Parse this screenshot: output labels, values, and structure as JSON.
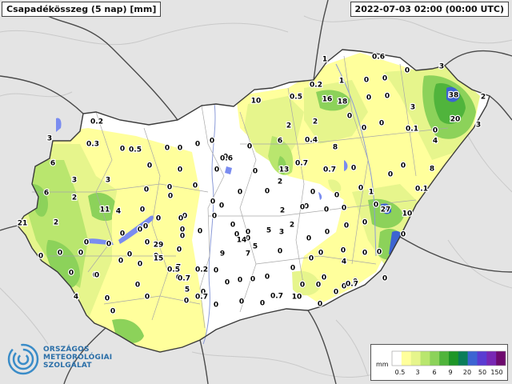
{
  "header": {
    "title": "Csapadékösszeg (5 nap) [mm]",
    "timestamp": "2022-07-03 02:00 (00:00 UTC)"
  },
  "logo": {
    "icon": "spiral-logo-icon",
    "lines": [
      "ORSZÁGOS",
      "METEOROLÓGIAI",
      "SZOLGÁLAT"
    ]
  },
  "legend": {
    "unit": "mm",
    "tick_labels": [
      "0.5",
      "3",
      "6",
      "9",
      "20",
      "50",
      "150"
    ],
    "colors": [
      "#ffffff",
      "#ffff9c",
      "#e6f58c",
      "#b9e66e",
      "#8cd25a",
      "#50b43c",
      "#1e9628",
      "#0a7d5a",
      "#3c64d2",
      "#5a3cd2",
      "#7828b4",
      "#6e0a6e"
    ]
  },
  "values": [
    "0.6",
    "1",
    "0",
    "0",
    "0",
    "3",
    "1",
    "0.2",
    "0",
    "0",
    "10",
    "0.5",
    "16",
    "18",
    "38",
    "2",
    "0",
    "0",
    "3",
    "20",
    "3",
    "0.2",
    "2",
    "2",
    "0",
    "0.1",
    "0",
    "3",
    "6",
    "0.4",
    "0",
    "4",
    "6",
    "8",
    "0",
    "0.3",
    "0.5",
    "0",
    "0",
    "0",
    "0",
    "0",
    "0.6",
    "0",
    "0",
    "0",
    "8",
    "0",
    "13",
    "0.7",
    "0.7",
    "0",
    "2",
    "3",
    "0",
    "0",
    "0",
    "0",
    "0",
    "0",
    "0",
    "1",
    "0",
    "0.1",
    "6",
    "2",
    "0",
    "0",
    "0",
    "0",
    "0",
    "0",
    "3",
    "11",
    "4",
    "0",
    "0",
    "2",
    "0",
    "0",
    "0",
    "0",
    "27",
    "10",
    "21",
    "2",
    "0",
    "0",
    "0",
    "0",
    "0",
    "0",
    "0",
    "0",
    "0",
    "0",
    "5",
    "3",
    "2",
    "0",
    "0",
    "0",
    "0",
    "0",
    "0",
    "29",
    "0",
    "9",
    "14",
    "5",
    "0",
    "0",
    "0",
    "0",
    "0",
    "0",
    "0",
    "0",
    "0",
    "0",
    "15",
    "7",
    "7",
    "0",
    "0",
    "0",
    "0",
    "0",
    "0",
    "0",
    "0",
    "0",
    "0",
    "0",
    "0.5",
    "0.2",
    "0",
    "0",
    "0",
    "0",
    "0",
    "4",
    "0",
    "0",
    "0",
    "0.7",
    "5",
    "0",
    "0",
    "0",
    "0",
    "0",
    "0",
    "0.7",
    "0",
    "4",
    "0",
    "0",
    "0",
    "0.7",
    "0",
    "0",
    "0",
    "0.7",
    "10",
    "0",
    "0",
    "0"
  ]
}
